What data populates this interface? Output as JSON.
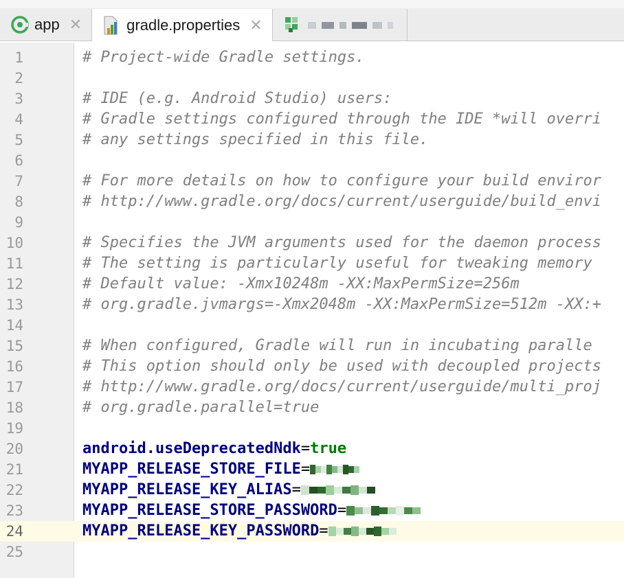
{
  "tabs": [
    {
      "label": "app",
      "icon": "android-module-icon",
      "active": false
    },
    {
      "label": "gradle.properties",
      "icon": "gradle-properties-icon",
      "active": true
    },
    {
      "label": "",
      "icon": "redacted-file-icon",
      "active": false
    }
  ],
  "editor": {
    "current_line": 24,
    "lines": [
      {
        "n": "1",
        "text": "# Project-wide Gradle settings."
      },
      {
        "n": "2",
        "text": ""
      },
      {
        "n": "3",
        "text": "# IDE (e.g. Android Studio) users:"
      },
      {
        "n": "4",
        "text": "# Gradle settings configured through the IDE *will overri"
      },
      {
        "n": "5",
        "text": "# any settings specified in this file."
      },
      {
        "n": "6",
        "text": ""
      },
      {
        "n": "7",
        "text": "# For more details on how to configure your build enviror"
      },
      {
        "n": "8",
        "text": "# http://www.gradle.org/docs/current/userguide/build_envi"
      },
      {
        "n": "9",
        "text": ""
      },
      {
        "n": "10",
        "text": "# Specifies the JVM arguments used for the daemon process"
      },
      {
        "n": "11",
        "text": "# The setting is particularly useful for tweaking memory"
      },
      {
        "n": "12",
        "text": "# Default value: -Xmx10248m -XX:MaxPermSize=256m"
      },
      {
        "n": "13",
        "text": "# org.gradle.jvmargs=-Xmx2048m -XX:MaxPermSize=512m -XX:+"
      },
      {
        "n": "14",
        "text": ""
      },
      {
        "n": "15",
        "text": "# When configured, Gradle will run in incubating paralle"
      },
      {
        "n": "16",
        "text": "# This option should only be used with decoupled projects"
      },
      {
        "n": "17",
        "text": "# http://www.gradle.org/docs/current/userguide/multi_proj"
      },
      {
        "n": "18",
        "text": "# org.gradle.parallel=true"
      },
      {
        "n": "19",
        "text": ""
      },
      {
        "n": "20",
        "key": "android.useDeprecatedNdk",
        "value": "true"
      },
      {
        "n": "21",
        "key": "MYAPP_RELEASE_STORE_FILE",
        "value": ""
      },
      {
        "n": "22",
        "key": "MYAPP_RELEASE_KEY_ALIAS",
        "value": ""
      },
      {
        "n": "23",
        "key": "MYAPP_RELEASE_STORE_PASSWORD",
        "value": ""
      },
      {
        "n": "24",
        "key": "MYAPP_RELEASE_KEY_PASSWORD",
        "value": ""
      },
      {
        "n": "25",
        "text": ""
      }
    ]
  },
  "colors": {
    "comment": "#808080",
    "key": "#000080",
    "value": "#007a00",
    "current_line": "#fffbe6",
    "gutter": "#f0f0f0"
  }
}
